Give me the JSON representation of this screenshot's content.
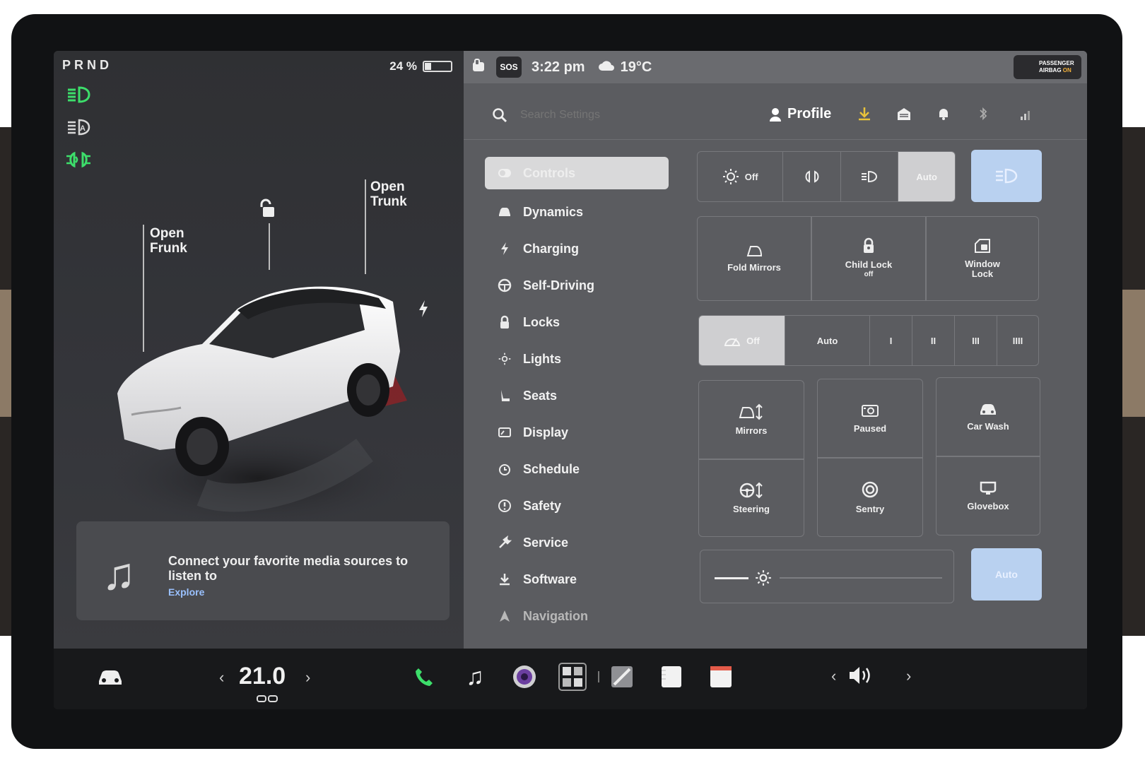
{
  "gear": "PRND",
  "battery": {
    "percent_label": "24 %",
    "level": 0.24
  },
  "callouts": {
    "frunk": "Open\nFrunk",
    "trunk": "Open\nTrunk"
  },
  "media": {
    "message": "Connect your favorite media sources to listen to",
    "link": "Explore"
  },
  "status_bar": {
    "sos": "SOS",
    "time": "3:22 pm",
    "weather": "19°C",
    "airbag_line1": "PASSENGER",
    "airbag_line2": "AIRBAG",
    "airbag_state": "ON"
  },
  "search": {
    "placeholder": "Search Settings"
  },
  "profile": {
    "label": "Profile"
  },
  "menu": [
    {
      "label": "Controls",
      "icon": "toggle-icon"
    },
    {
      "label": "Dynamics",
      "icon": "car-icon"
    },
    {
      "label": "Charging",
      "icon": "bolt-icon"
    },
    {
      "label": "Self-Driving",
      "icon": "steering-icon"
    },
    {
      "label": "Locks",
      "icon": "lock-icon"
    },
    {
      "label": "Lights",
      "icon": "sun-icon"
    },
    {
      "label": "Seats",
      "icon": "seat-icon"
    },
    {
      "label": "Display",
      "icon": "display-icon"
    },
    {
      "label": "Schedule",
      "icon": "alarm-icon"
    },
    {
      "label": "Safety",
      "icon": "alert-icon"
    },
    {
      "label": "Service",
      "icon": "wrench-icon"
    },
    {
      "label": "Software",
      "icon": "download-icon"
    },
    {
      "label": "Navigation",
      "icon": "nav-icon"
    }
  ],
  "lights_segment": {
    "off": "Off",
    "auto": "Auto"
  },
  "tiles_row1": {
    "fold_mirrors": "Fold Mirrors",
    "child_lock": "Child Lock",
    "child_lock_state": "off",
    "window_lock_1": "Window",
    "window_lock_2": "Lock"
  },
  "wiper_segment": {
    "off": "Off",
    "auto": "Auto",
    "speeds": [
      "I",
      "II",
      "III",
      "IIII"
    ]
  },
  "tiles_grid": {
    "mirrors": "Mirrors",
    "paused": "Paused",
    "car_wash": "Car Wash",
    "steering": "Steering",
    "sentry": "Sentry",
    "glovebox": "Glovebox"
  },
  "brightness": {
    "auto": "Auto"
  },
  "dock": {
    "temperature": "21.0",
    "left_arrow": "‹",
    "right_arrow": "›"
  },
  "colors": {
    "accent_blue": "#b9d1f0",
    "green_indicator": "#3dde6b",
    "download_yellow": "#e8c23a"
  }
}
